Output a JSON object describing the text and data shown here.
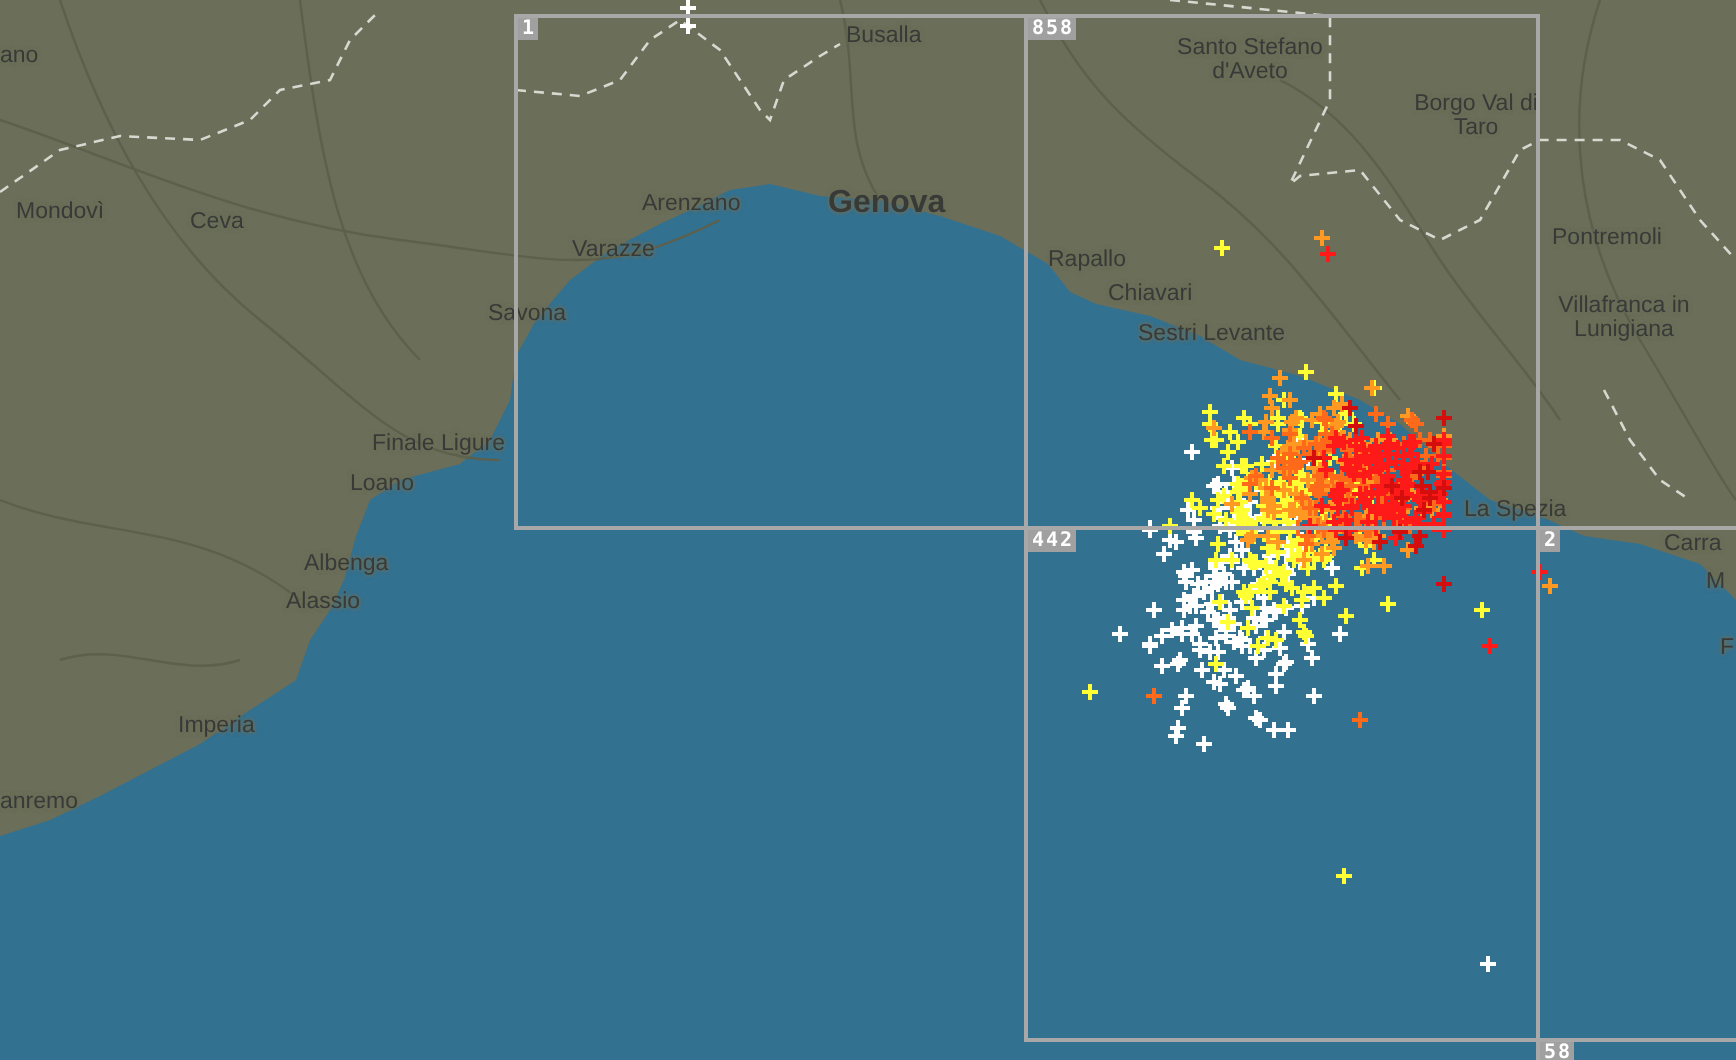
{
  "map": {
    "labels": [
      {
        "text": "ano",
        "kind": "town"
      },
      {
        "text": "Mondovì",
        "kind": "town"
      },
      {
        "text": "Ceva",
        "kind": "town"
      },
      {
        "text": "Busalla",
        "kind": "town"
      },
      {
        "text": "Santo Stefano d'Aveto",
        "kind": "town"
      },
      {
        "text": "Borgo Val di Taro",
        "kind": "town"
      },
      {
        "text": "Pontremoli",
        "kind": "town"
      },
      {
        "text": "Villafranca in Lunigiana",
        "kind": "town"
      },
      {
        "text": "Arenzano",
        "kind": "town"
      },
      {
        "text": "Genova",
        "kind": "city"
      },
      {
        "text": "Varazze",
        "kind": "town"
      },
      {
        "text": "Savona",
        "kind": "town"
      },
      {
        "text": "Rapallo",
        "kind": "town"
      },
      {
        "text": "Chiavari",
        "kind": "town"
      },
      {
        "text": "Sestri Levante",
        "kind": "town"
      },
      {
        "text": "Finale Ligure",
        "kind": "town"
      },
      {
        "text": "Loano",
        "kind": "town"
      },
      {
        "text": "La Spezia",
        "kind": "town"
      },
      {
        "text": "Carra",
        "kind": "town"
      },
      {
        "text": "Albenga",
        "kind": "town"
      },
      {
        "text": "Alassio",
        "kind": "town"
      },
      {
        "text": "M",
        "kind": "town"
      },
      {
        "text": "F",
        "kind": "town"
      },
      {
        "text": "Imperia",
        "kind": "town"
      },
      {
        "text": "anremo",
        "kind": "town"
      }
    ],
    "grid_cells": [
      {
        "count": "1"
      },
      {
        "count": "858"
      },
      {
        "count": "442"
      },
      {
        "count": "2"
      },
      {
        "count": "58"
      }
    ]
  }
}
